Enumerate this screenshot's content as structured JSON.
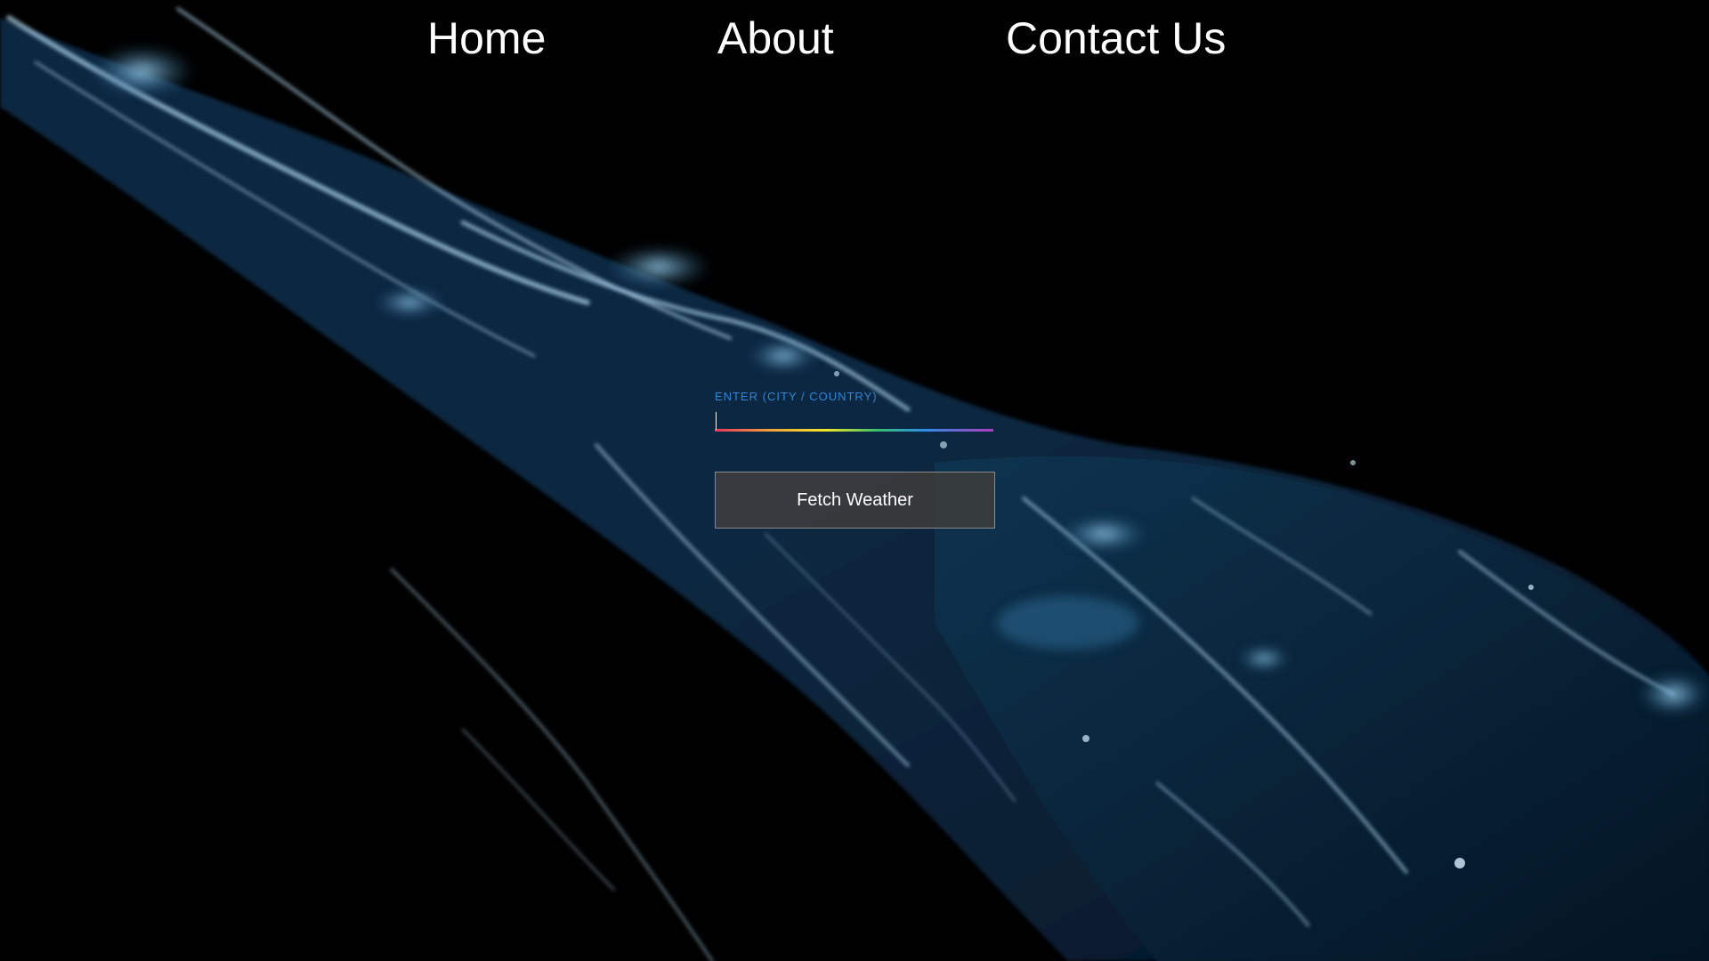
{
  "nav": {
    "home_label": "Home",
    "about_label": "About",
    "contact_label": "Contact Us"
  },
  "search": {
    "label": "ENTER (CITY / COUNTRY)",
    "value": "",
    "placeholder": ""
  },
  "actions": {
    "fetch_label": "Fetch Weather"
  },
  "colors": {
    "background": "#000000",
    "nav_text": "#ffffff",
    "label_text": "#2f86d8",
    "button_bg": "#3c3c3c",
    "button_border": "#8a8a8a",
    "underline_gradient": [
      "#e8365d",
      "#f2e72a",
      "#2d8fe8",
      "#b03cc0"
    ]
  },
  "background": {
    "icon": "water-splash-video-background"
  }
}
